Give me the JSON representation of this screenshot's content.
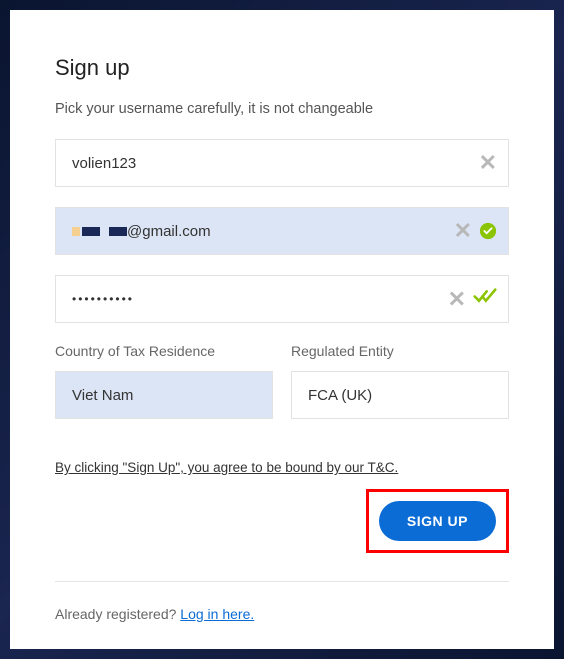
{
  "title": "Sign up",
  "subtitle": "Pick your username carefully, it is not changeable",
  "username": {
    "value": "volien123"
  },
  "email": {
    "suffix": "@gmail.com"
  },
  "password": {
    "masked": "••••••••••"
  },
  "country": {
    "label": "Country of Tax Residence",
    "value": "Viet Nam"
  },
  "entity": {
    "label": "Regulated Entity",
    "value": "FCA (UK)"
  },
  "terms_text": "By clicking \"Sign Up\", you agree to be bound by our T&C.",
  "signup_btn": "SIGN UP",
  "footer": {
    "text": "Already registered? ",
    "link": "Log in here."
  },
  "colors": {
    "accent": "#0b6cd6",
    "valid": "#8bc400",
    "highlight": "#ff0000"
  }
}
